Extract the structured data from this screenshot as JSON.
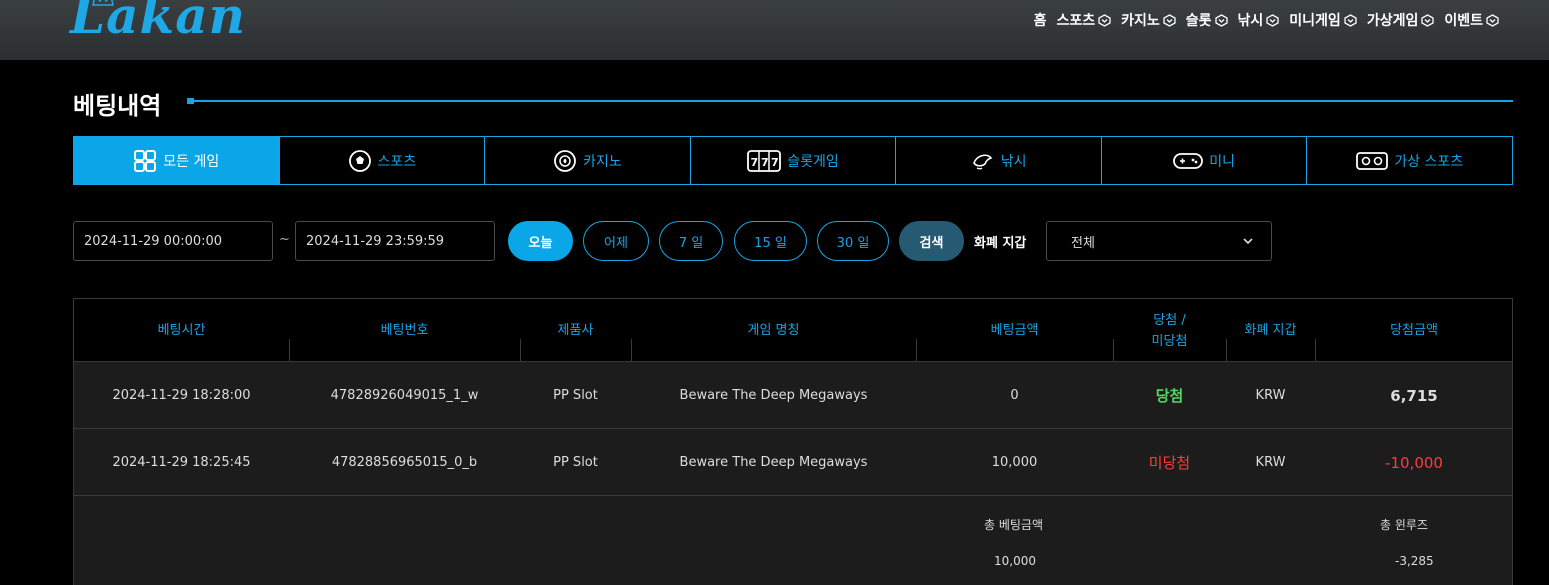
{
  "brand": {
    "logo_text": "Lakan",
    "accent": "#17a4e6"
  },
  "nav": [
    {
      "label": "홈",
      "has_menu": false
    },
    {
      "label": "스포츠",
      "has_menu": true
    },
    {
      "label": "카지노",
      "has_menu": true
    },
    {
      "label": "슬롯",
      "has_menu": true
    },
    {
      "label": "낚시",
      "has_menu": true
    },
    {
      "label": "미니게임",
      "has_menu": true
    },
    {
      "label": "가상게임",
      "has_menu": true
    },
    {
      "label": "이벤트",
      "has_menu": true
    }
  ],
  "page": {
    "title": "베팅내역"
  },
  "tabs": [
    {
      "label": "모든 게임",
      "icon": "grid-icon",
      "active": true
    },
    {
      "label": "스포츠",
      "icon": "soccer-ball-icon",
      "active": false
    },
    {
      "label": "카지노",
      "icon": "poker-chip-icon",
      "active": false
    },
    {
      "label": "슬롯게임",
      "icon": "slot-777-icon",
      "active": false
    },
    {
      "label": "낚시",
      "icon": "fish-icon",
      "active": false
    },
    {
      "label": "미니",
      "icon": "gamepad-icon",
      "active": false
    },
    {
      "label": "가상 스포츠",
      "icon": "vr-headset-icon",
      "active": false
    }
  ],
  "filters": {
    "date_from": "2024-11-29 00:00:00",
    "tilde": "~",
    "date_to": "2024-11-29 23:59:59",
    "quick_ranges": [
      "오늘",
      "어제",
      "7 일",
      "15 일",
      "30 일"
    ],
    "active_range": "오늘",
    "search_label": "검색",
    "currency_label": "화폐 지갑",
    "currency_value": "전체"
  },
  "table": {
    "headers": [
      "베팅시간",
      "베팅번호",
      "제품사",
      "게임 명칭",
      "베팅금액",
      "당첨 /\n미당첨",
      "화폐 지갑",
      "당첨금액"
    ],
    "rows": [
      {
        "time": "2024-11-29 18:28:00",
        "id": "47828926049015_1_w",
        "provider": "PP Slot",
        "game": "Beware The Deep Megaways",
        "bet": "0",
        "result": "당첨",
        "status": "win",
        "currency": "KRW",
        "payout": "6,715"
      },
      {
        "time": "2024-11-29 18:25:45",
        "id": "47828856965015_0_b",
        "provider": "PP Slot",
        "game": "Beware The Deep Megaways",
        "bet": "10,000",
        "result": "미당첨",
        "status": "lose",
        "currency": "KRW",
        "payout": "-10,000"
      }
    ],
    "summary": {
      "total_bet_label": "총 베팅금액",
      "total_bet": "10,000",
      "total_winloss_label": "총 윈루즈",
      "total_winloss": "-3,285"
    }
  }
}
